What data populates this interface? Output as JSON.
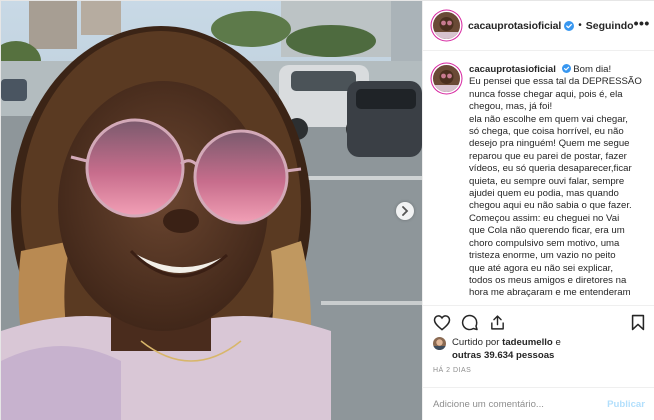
{
  "post": {
    "username": "cacauprotasioficial",
    "follow_state": "Seguindo",
    "more_label": "•••",
    "caption_lines": [
      "Bom dia!",
      "Eu pensei que essa tal da DEPRESSÃO",
      "nunca fosse chegar aqui, pois é, ela",
      "chegou, mas, já foi!",
      "ela não escolhe em quem vai chegar,",
      "só chega, que coisa horrível, eu não",
      "desejo pra ninguém! Quem me segue",
      "reparou que eu parei de postar, fazer",
      "vídeos, eu só queria desaparecer,ficar",
      "quieta, eu sempre ouvi falar, sempre",
      "ajudei quem eu podia, mas quando",
      "chegou aqui eu não sabia o que fazer.",
      "Começou assim: eu cheguei no Vai",
      "que Cola não querendo ficar, era um",
      "choro compulsivo sem motivo, uma",
      "tristeza enorme, um vazio no peito",
      "que até agora eu não sei explicar,",
      "todos os meus amigos e diretores na",
      "hora me abraçaram e me entenderam"
    ],
    "likes": {
      "line1_prefix": "Curtido por",
      "liker": "tadeumello",
      "line1_suffix": "e",
      "line2_count": "outras 39.634 pessoas"
    },
    "time_ago": "HÁ 2 DIAS",
    "comment_placeholder": "Adicione um comentário...",
    "publish_label": "Publicar"
  },
  "icons": {
    "verified": "verified-badge-icon",
    "like": "heart-icon",
    "comment": "comment-bubble-icon",
    "share": "share-icon",
    "save": "bookmark-icon",
    "next": "chevron-right-icon"
  },
  "colors": {
    "verified_blue": "#3897f0",
    "publish_disabled": "#b2dffc",
    "story_ring": "#d6249f",
    "muted": "#8e8e8e"
  }
}
